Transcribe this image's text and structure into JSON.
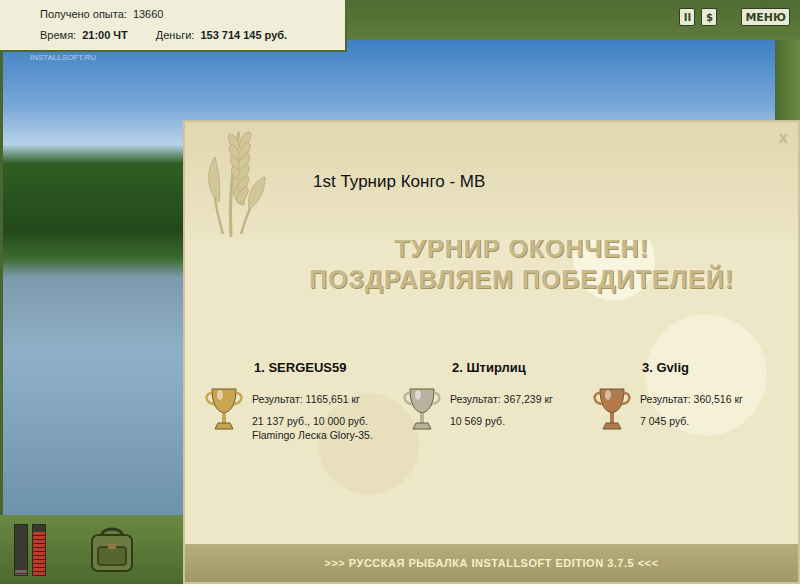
{
  "hud": {
    "experience_label": "Получено опыта:",
    "experience": "13660",
    "time_label": "Время:",
    "time": "21:00 ЧТ",
    "money_label": "Деньги:",
    "money": "153 714 145 руб."
  },
  "watermark": "INSTALLSOFT.RU",
  "toolbar": {
    "buttons": [
      "II",
      "$",
      "МЕНЮ"
    ]
  },
  "meters": [
    {
      "level": 0.1,
      "color": "#6b6b6b"
    },
    {
      "level": 0.85,
      "color": "#c0392b"
    }
  ],
  "dialog": {
    "title": "1st Турнир Конго - МВ",
    "close": "x",
    "headline": [
      "ТУРНИР ОКОНЧЕН!",
      "ПОЗДРАВЛЯЕМ ПОБЕДИТЕЛЕЙ!"
    ],
    "winners": [
      {
        "place": "1. SERGEUS59",
        "result": "Результат: 1165,651 кг",
        "prizes": [
          "21 137 руб., 10 000 руб.",
          "Flamingo Леска Glory-35."
        ],
        "color": "#c9a54e"
      },
      {
        "place": "2. Штирлиц",
        "result": "Результат: 367,239 кг",
        "prizes": [
          "10 569 руб."
        ],
        "color": "#b9b2a0"
      },
      {
        "place": "3. Gvlig",
        "result": "Результат: 360,516 кг",
        "prizes": [
          "7 045 руб."
        ],
        "color": "#b07a4a"
      }
    ],
    "footer": ">>> РУССКАЯ РЫБАЛКА INSTALLSOFT EDITION 3.7.5 <<<"
  }
}
